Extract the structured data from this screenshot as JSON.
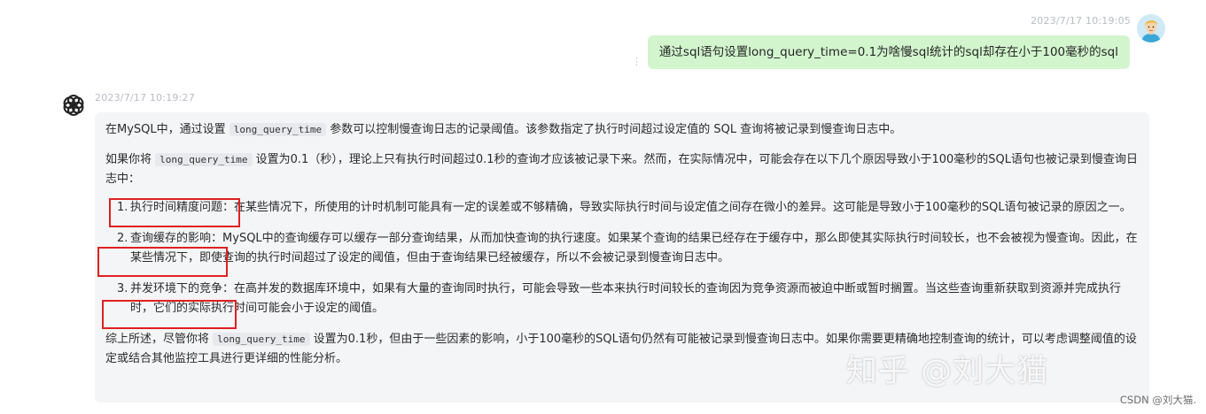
{
  "user_message": {
    "timestamp": "2023/7/17 10:19:05",
    "text": "通过sql语句设置long_query_time=0.1为啥慢sql统计的sql却存在小于100毫秒的sql",
    "menu_icon": "vertical-ellipsis-icon"
  },
  "ai_message": {
    "timestamp": "2023/7/17 10:19:27",
    "avatar_icon": "openai-logo-icon",
    "p1": {
      "before": "在MySQL中，通过设置",
      "code": "long_query_time",
      "after": "参数可以控制慢查询日志的记录阈值。该参数指定了执行时间超过设定值的 SQL 查询将被记录到慢查询日志中。"
    },
    "p2": {
      "before": "如果你将",
      "code": "long_query_time",
      "after": "设置为0.1（秒），理论上只有执行时间超过0.1秒的查询才应该被记录下来。然而，在实际情况中，可能会存在以下几个原因导致小于100毫秒的SQL语句也被记录到慢查询日志中："
    },
    "items": [
      {
        "num": "1.",
        "title": "执行时间精度问题",
        "colon": "：",
        "body": "在某些情况下，所使用的计时机制可能具有一定的误差或不够精确，导致实际执行时间与设定值之间存在微小的差异。这可能是导致小于100毫秒的SQL语句被记录的原因之一。"
      },
      {
        "num": "2.",
        "title": "查询缓存的影响",
        "colon": "：",
        "body": "MySQL中的查询缓存可以缓存一部分查询结果，从而加快查询的执行速度。如果某个查询的结果已经存在于缓存中，那么即使其实际执行时间较长，也不会被视为慢查询。因此，在某些情况下，即使查询的执行时间超过了设定的阈值，但由于查询结果已经被缓存，所以不会被记录到慢查询日志中。"
      },
      {
        "num": "3.",
        "title": "并发环境下的竞争",
        "colon": "：",
        "body": "在高并发的数据库环境中，如果有大量的查询同时执行，可能会导致一些本来执行时间较长的查询因为竞争资源而被迫中断或暂时搁置。当这些查询重新获取到资源并完成执行时，它们的实际执行时间可能会小于设定的阈值。"
      }
    ],
    "p3": {
      "before": "综上所述，尽管你将",
      "code": "long_query_time",
      "after": "设置为0.1秒，但由于一些因素的影响，小于100毫秒的SQL语句仍然有可能被记录到慢查询日志中。如果你需要更精确地控制查询的统计，可以考虑调整阈值的设定或结合其他监控工具进行更详细的性能分析。"
    }
  },
  "watermarks": {
    "zhihu": "知乎 @刘大猫",
    "csdn": "CSDN @刘大猫."
  },
  "colors": {
    "user_bubble": "#d2f5cd",
    "ai_bubble": "#f4f5f7",
    "highlight_box": "#e02020",
    "timestamp": "#b9bcc3"
  }
}
